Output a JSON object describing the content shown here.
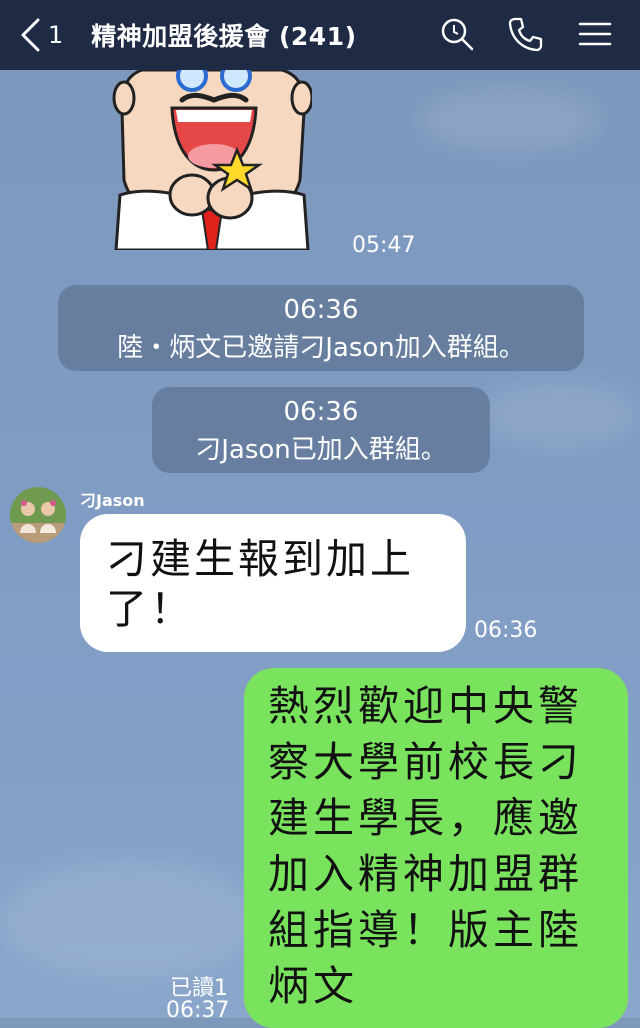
{
  "header": {
    "unread_count": "1",
    "title": "精神加盟後援會 (241)"
  },
  "icons": {
    "back": "chevron-left-icon",
    "search": "search-icon",
    "call": "phone-icon",
    "menu": "hamburger-menu-icon"
  },
  "messages": {
    "sticker_time": "05:47",
    "notice1_time": "06:36",
    "notice1_text": "陸・炳文已邀請刁Jason加入群組。",
    "notice2_time": "06:36",
    "notice2_text": "刁Jason已加入群組。",
    "incoming_sender": "刁Jason",
    "incoming_text": "刁建生報到加上了！",
    "incoming_time": "06:36",
    "outgoing_text": "熱烈歡迎中央警察大學前校長刁建生學長，應邀加入精神加盟群組指導！版主陸炳文",
    "outgoing_read": "已讀1",
    "outgoing_time": "06:37"
  },
  "colors": {
    "header_bg": "#1f2a44",
    "outgoing_bubble": "#79e35e",
    "incoming_bubble": "#ffffff"
  }
}
